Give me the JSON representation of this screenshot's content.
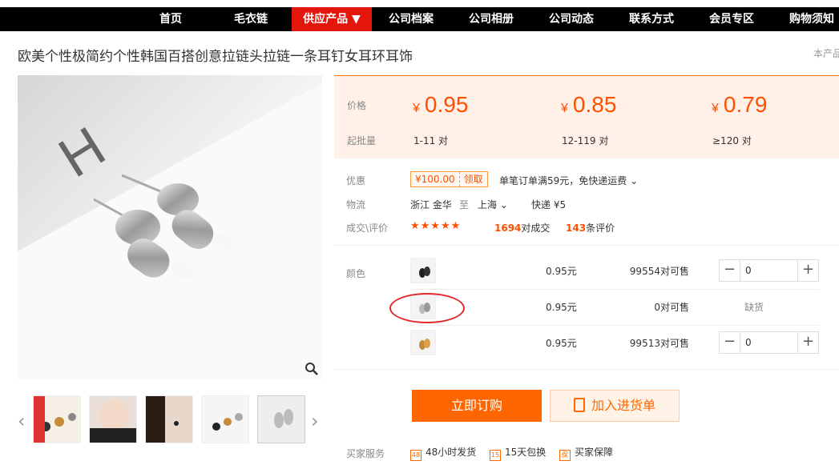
{
  "nav": [
    "首页",
    "毛衣链",
    "供应产品 ▼",
    "公司档案",
    "公司相册",
    "公司动态",
    "联系方式",
    "会员专区",
    "购物须知"
  ],
  "title": "欧美个性极简约个性韩国百搭创意拉链头拉链一条耳钉女耳环耳饰",
  "title_right": "本产品",
  "price_box": {
    "price_label": "价格",
    "qty_label": "起批量",
    "currency": "¥",
    "tiers": [
      {
        "price": "0.95",
        "qty": "1-11 对"
      },
      {
        "price": "0.85",
        "qty": "12-119 对"
      },
      {
        "price": "0.79",
        "qty": "≥120 对"
      }
    ]
  },
  "discount": {
    "label": "优惠",
    "amount": "¥100.00",
    "claim": "领取",
    "text": "单笔订单满59元，免快递运费 ⌄"
  },
  "logistics": {
    "label": "物流",
    "from": "浙江 金华",
    "to_word": "至",
    "to": "上海 ⌄",
    "fee": "快递 ¥5"
  },
  "rating": {
    "label": "成交\\评价",
    "stars": "★★★★★",
    "sales_num": "1694",
    "sales_suffix": "对成交",
    "reviews_num": "143",
    "reviews_suffix": "条评价"
  },
  "sku": {
    "label": "颜色",
    "rows": [
      {
        "price": "0.95元",
        "stock_num": "99554",
        "stock_suffix": "对可售",
        "qty": "0",
        "oos": ""
      },
      {
        "price": "0.95元",
        "stock_num": "0",
        "stock_suffix": "对可售",
        "qty": "",
        "oos": "缺货"
      },
      {
        "price": "0.95元",
        "stock_num": "99513",
        "stock_suffix": "对可售",
        "qty": "0",
        "oos": ""
      }
    ]
  },
  "buttons": {
    "buy": "立即订购",
    "cart": "加入进货单"
  },
  "services": {
    "label": "买家服务",
    "items": [
      {
        "icon": "48",
        "text": "48小时发货"
      },
      {
        "icon": "15",
        "text": "15天包换"
      },
      {
        "icon": "保",
        "text": "买家保障"
      }
    ]
  },
  "colors": {
    "accent": "#ff5000",
    "nav_active": "#e4150c",
    "annotation": "#e3262b"
  }
}
